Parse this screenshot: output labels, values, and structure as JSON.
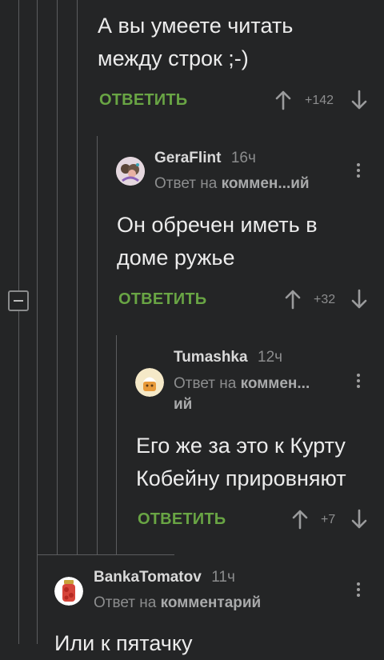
{
  "colors": {
    "background": "#242526",
    "reply_green": "#69a544",
    "thread_line": "#5c5d5f",
    "muted": "#8c8d8e"
  },
  "comments": [
    {
      "text": "А вы умеете читать\nмежду строк ;-)",
      "reply_label": "ОТВЕТИТЬ",
      "score": "+142"
    },
    {
      "author": "GeraFlint",
      "time": "16ч",
      "reply_prefix": "Ответ на",
      "reply_target": "коммен...ий",
      "text": "Он обречен иметь в\nдоме ружье",
      "reply_label": "ОТВЕТИТЬ",
      "score": "+32"
    },
    {
      "author": "Tumashka",
      "time": "12ч",
      "reply_prefix": "Ответ на",
      "reply_target": "коммен...",
      "reply_target_line2": "ий",
      "text": "Его же за это к Курту\nКобейну прировняют",
      "reply_label": "ОТВЕТИТЬ",
      "score": "+7"
    },
    {
      "author": "BankaTomatov",
      "time": "11ч",
      "reply_prefix": "Ответ на",
      "reply_target": "комментарий",
      "text": "Или к пятачку"
    }
  ],
  "icons": {
    "upvote": "arrow-up-icon",
    "downvote": "arrow-down-icon",
    "more": "more-vertical-icon",
    "collapse": "collapse-thread-icon"
  }
}
